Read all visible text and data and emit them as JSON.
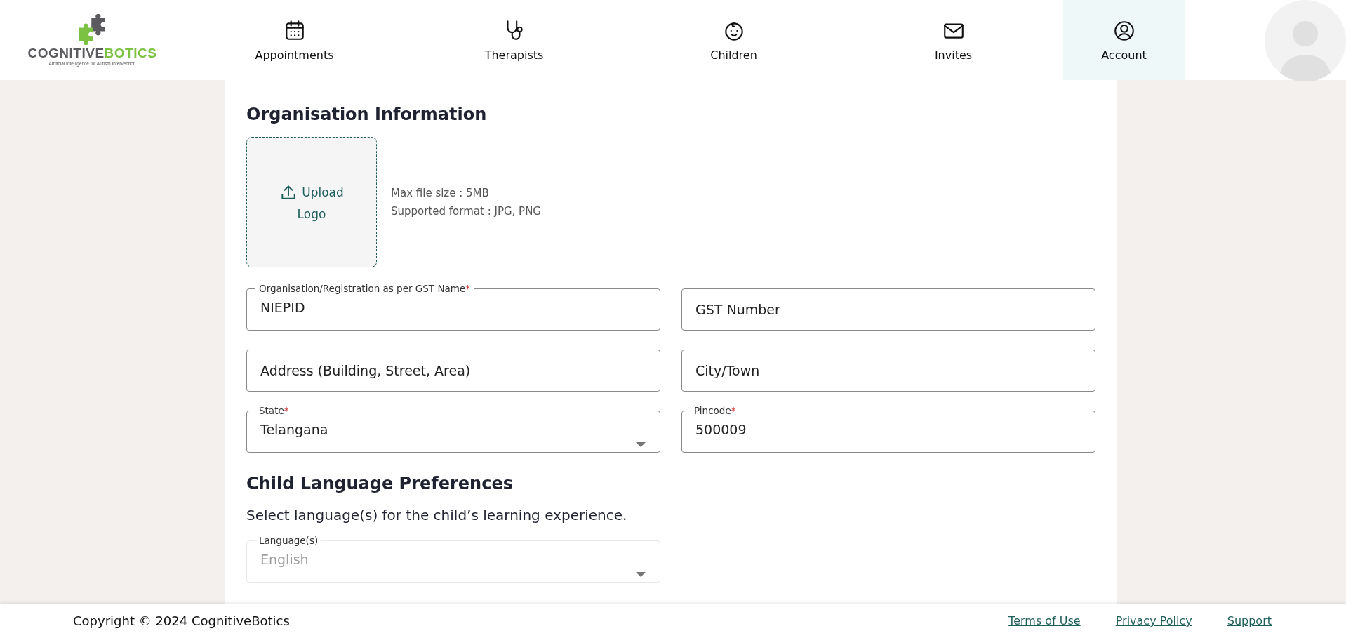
{
  "header": {
    "logo": {
      "name_dark": "COGNITIVE",
      "name_green": "BOTICS",
      "tagline": "Artificial Intelligence for Autism Intervention"
    },
    "nav": [
      {
        "label": "Appointments",
        "selected": false
      },
      {
        "label": "Therapists",
        "selected": false
      },
      {
        "label": "Children",
        "selected": false
      },
      {
        "label": "Invites",
        "selected": false
      },
      {
        "label": "Account",
        "selected": true
      }
    ]
  },
  "organisation": {
    "heading": "Organisation Information",
    "upload": {
      "label_1": "Upload",
      "label_2": "Logo"
    },
    "hints": [
      "Max file size : 5MB",
      "Supported format : JPG, PNG"
    ],
    "fields": [
      {
        "kind": "text",
        "label": "Organisation/Registration as per GST Name",
        "required_mark": "*",
        "value": "NIEPID"
      },
      {
        "kind": "text",
        "placeholder": "GST Number"
      },
      {
        "kind": "text",
        "placeholder": "Address (Building, Street, Area)"
      },
      {
        "kind": "text",
        "placeholder": "City/Town"
      },
      {
        "kind": "select",
        "label": "State",
        "required_mark": "*",
        "value": "Telangana"
      },
      {
        "kind": "text",
        "label": "Pincode",
        "required_mark": "*",
        "value": "500009"
      }
    ]
  },
  "languages": {
    "heading": "Child Language Preferences",
    "description": "Select language(s) for the child’s learning experience.",
    "field": {
      "kind": "select",
      "label": "Language(s)",
      "value": "English",
      "disabled": true
    }
  },
  "footer": {
    "copyright": "Copyright © 2024 CognitiveBotics",
    "links": [
      "Terms of Use",
      "Privacy Policy",
      "Support"
    ]
  }
}
